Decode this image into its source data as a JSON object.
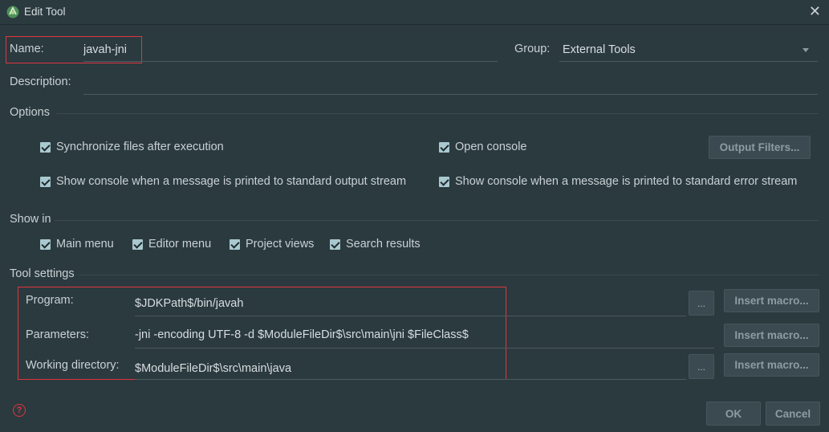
{
  "window": {
    "title": "Edit Tool"
  },
  "name": {
    "label": "Name:",
    "value": "javah-jni"
  },
  "group": {
    "label": "Group:",
    "value": "External Tools"
  },
  "description": {
    "label": "Description:",
    "value": ""
  },
  "options": {
    "title": "Options",
    "sync_files": "Synchronize files after execution",
    "open_console": "Open console",
    "output_filters": "Output Filters...",
    "show_console_stdout": "Show console when a message is printed to standard output stream",
    "show_console_stderr": "Show console when a message is printed to standard error stream"
  },
  "show_in": {
    "title": "Show in",
    "items": [
      "Main menu",
      "Editor menu",
      "Project views",
      "Search results"
    ]
  },
  "tool_settings": {
    "title": "Tool settings",
    "program": {
      "label": "Program:",
      "value": "$JDKPath$/bin/javah"
    },
    "parameters": {
      "label": "Parameters:",
      "value": "-jni  -encoding UTF-8 -d  $ModuleFileDir$\\src\\main\\jni $FileClass$"
    },
    "working_directory": {
      "label": "Working directory:",
      "value": "$ModuleFileDir$\\src\\main\\java"
    },
    "browse": "...",
    "insert_macro": "Insert macro..."
  },
  "buttons": {
    "ok": "OK",
    "cancel": "Cancel"
  },
  "help": "?"
}
